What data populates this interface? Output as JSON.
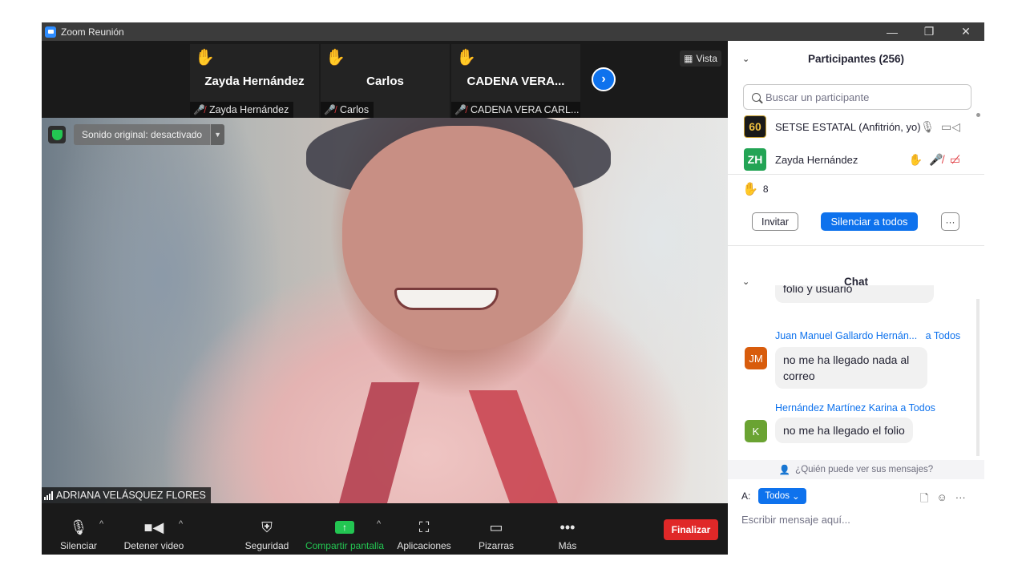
{
  "window": {
    "title": "Zoom Reunión",
    "controls": [
      "—",
      "❐",
      "✕"
    ]
  },
  "thumbnails": [
    {
      "name": "Zayda Hernández",
      "label": "Zayda Hernández"
    },
    {
      "name": "Carlos",
      "label": "Carlos"
    },
    {
      "name": "CADENA VERA...",
      "label": "CADENA VERA CARL..."
    }
  ],
  "view_button": {
    "label": "Vista"
  },
  "main_video": {
    "original_sound": "Sonido original: desactivado",
    "speaker_name": "ADRIANA VELÁSQUEZ FLORES"
  },
  "toolbar": {
    "mute": "Silenciar",
    "stop_video": "Detener video",
    "security": "Seguridad",
    "share_screen": "Compartir pantalla",
    "apps": "Aplicaciones",
    "whiteboards": "Pizarras",
    "more": "Más",
    "end": "Finalizar",
    "share_color": "#23c552",
    "end_color": "#e02828"
  },
  "participants": {
    "header": "Participantes (256)",
    "search_placeholder": "Buscar un participante",
    "list": [
      {
        "avatar": "60",
        "name": "SETSE ESTATAL (Anfitrión, yo)",
        "avatar_color": "#1a1a1a"
      },
      {
        "avatar": "ZH",
        "name": "Zayda Hernández",
        "avatar_color": "#23a455"
      }
    ],
    "raised_hands_count": "8",
    "invite": "Invitar",
    "mute_all": "Silenciar a todos",
    "more": "···"
  },
  "chat": {
    "header": "Chat",
    "messages": [
      {
        "text": "folio y usuario"
      },
      {
        "sender": "Juan Manuel Gallardo Hernán...",
        "to": "a Todos",
        "avatar": "JM",
        "avatar_color": "#d85c0c",
        "text": "no me ha llegado nada al correo"
      },
      {
        "sender": "Hernández Martínez Karina",
        "to": "a Todos",
        "avatar": "K",
        "avatar_color": "#6aa332",
        "text": "no me ha llegado el folio"
      }
    ],
    "privacy": "¿Quién puede ver sus mensajes?",
    "to_label": "A:",
    "to_value": "Todos",
    "input_placeholder": "Escribir mensaje aquí..."
  }
}
